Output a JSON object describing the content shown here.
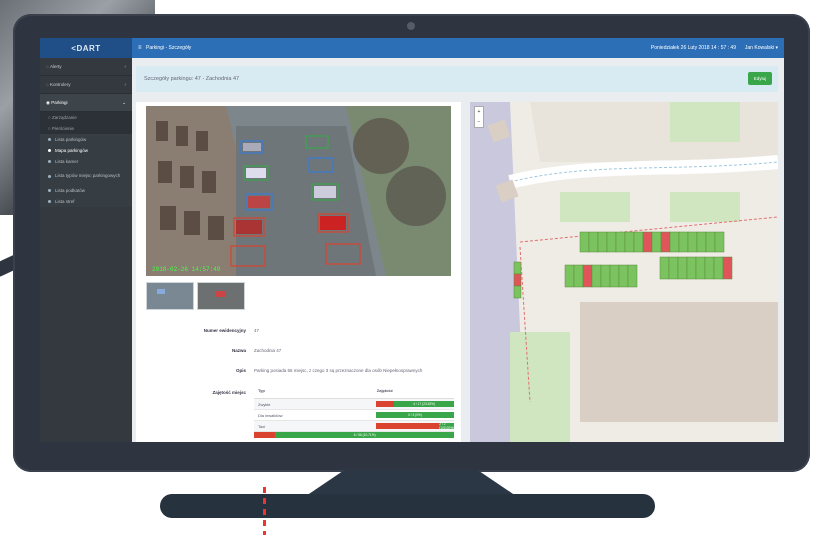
{
  "app": {
    "logo": "<DART",
    "breadcrumb": "Parkingi - Szczegóły",
    "datetime": "Poniedziałek 26 Luty 2018   14 : 57 : 49",
    "user": "Jan Kowalski ▾"
  },
  "sidebar": {
    "items": [
      {
        "label": "Alerty"
      },
      {
        "label": "Kontrolery"
      },
      {
        "label": "Parkingi"
      }
    ],
    "subs": [
      {
        "label": "Zarządzanie"
      },
      {
        "label": "Pierścienie"
      }
    ],
    "leafs": [
      {
        "label": "Lista parkingów"
      },
      {
        "label": "Mapa parkingów"
      },
      {
        "label": "Lista kamer"
      },
      {
        "label": "Lista typów miejsc parkingowych"
      },
      {
        "label": "Lista podkatów"
      },
      {
        "label": "Lista stref"
      }
    ]
  },
  "page": {
    "title": "Szczegóły parkingu: 47 - Zachodnia 47",
    "edit_button": "Edytuj",
    "camera_timestamp": "2018-02-26 14:57:49"
  },
  "details": {
    "id_label": "Numer ewidencyjny",
    "id_value": "47",
    "name_label": "Nazwa",
    "name_value": "Zachodnia 47",
    "desc_label": "Opis",
    "desc_value": "Parking posiada 56 miejsc, z czego 3 są przeznaczone dla osób Niepełnosprawnych",
    "occupancy_label": "Zajętość miejsc"
  },
  "occupancy": {
    "col_type": "Typ",
    "col_occ": "Zajętość",
    "rows": [
      {
        "type": "Zwykłe",
        "text": "4 / 17 (23.53%)",
        "pct": 23.53
      },
      {
        "type": "Dla inwalidów",
        "text": "0 / 3 (0%)",
        "pct": 0
      },
      {
        "type": "Taxi",
        "text": "2 / 2 (100.00%)",
        "pct": 100
      }
    ],
    "total": {
      "text": "6 / 56 (10.71%)",
      "pct": 10.71
    }
  },
  "colors": {
    "topbar": "#2d6fb7",
    "sidebar": "#33393f",
    "green": "#3aa64a",
    "red": "#d9432f"
  }
}
